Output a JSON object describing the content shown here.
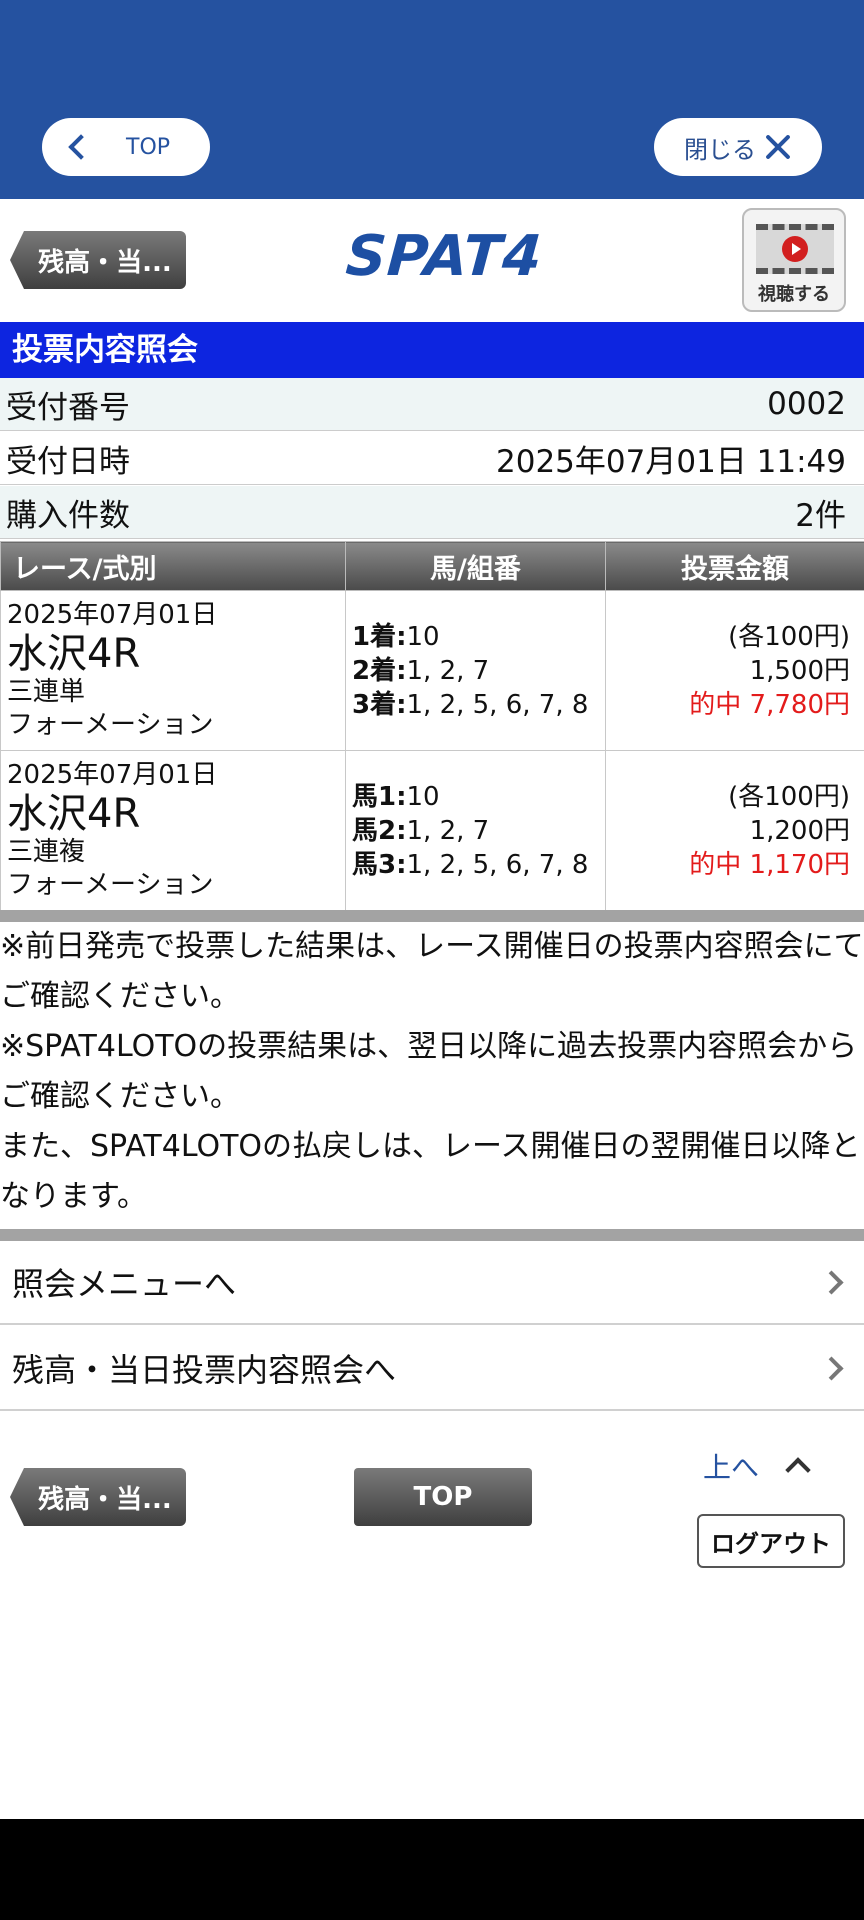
{
  "topbar": {
    "back_label": "TOP",
    "close_label": "閉じる"
  },
  "header": {
    "balance_button": "残高・当...",
    "logo": "SPAT4",
    "watch_label": "視聴する"
  },
  "section_title": "投票内容照会",
  "info": [
    {
      "label": "受付番号",
      "value": "0002"
    },
    {
      "label": "受付日時",
      "value": "2025年07月01日 11:49"
    },
    {
      "label": "購入件数",
      "value": "2件"
    }
  ],
  "table": {
    "headers": [
      "レース/式別",
      "馬/組番",
      "投票金額"
    ],
    "rows": [
      {
        "date": "2025年07月01日",
        "race": "水沢4R",
        "bet_type": "三連単",
        "method": "フォーメーション",
        "combo": [
          {
            "k": "1着:",
            "v": "10"
          },
          {
            "k": "2着:",
            "v": "1, 2, 7"
          },
          {
            "k": "3着:",
            "v": "1, 2, 5, 6, 7, 8"
          }
        ],
        "unit": "(各100円)",
        "total": "1,500円",
        "hit": "的中  7,780円"
      },
      {
        "date": "2025年07月01日",
        "race": "水沢4R",
        "bet_type": "三連複",
        "method": "フォーメーション",
        "combo": [
          {
            "k": "馬1:",
            "v": "10"
          },
          {
            "k": "馬2:",
            "v": "1, 2, 7"
          },
          {
            "k": "馬3:",
            "v": "1, 2, 5, 6, 7, 8"
          }
        ],
        "unit": "(各100円)",
        "total": "1,200円",
        "hit": "的中  1,170円"
      }
    ]
  },
  "notes": [
    "※前日発売で投票した結果は、レース開催日の投票内容照会にてご確認ください。",
    "※SPAT4LOTOの投票結果は、翌日以降に過去投票内容照会からご確認ください。",
    "また、SPAT4LOTOの払戻しは、レース開催日の翌開催日以降となります。"
  ],
  "menu": [
    "照会メニューへ",
    "残高・当日投票内容照会へ"
  ],
  "footer": {
    "balance_button": "残高・当...",
    "top_button": "TOP",
    "up_link": "上へ",
    "logout": "ログアウト"
  },
  "colors": {
    "brand": "#2552a0",
    "title_bar": "#0d25e0",
    "hit": "#e31b1b"
  }
}
